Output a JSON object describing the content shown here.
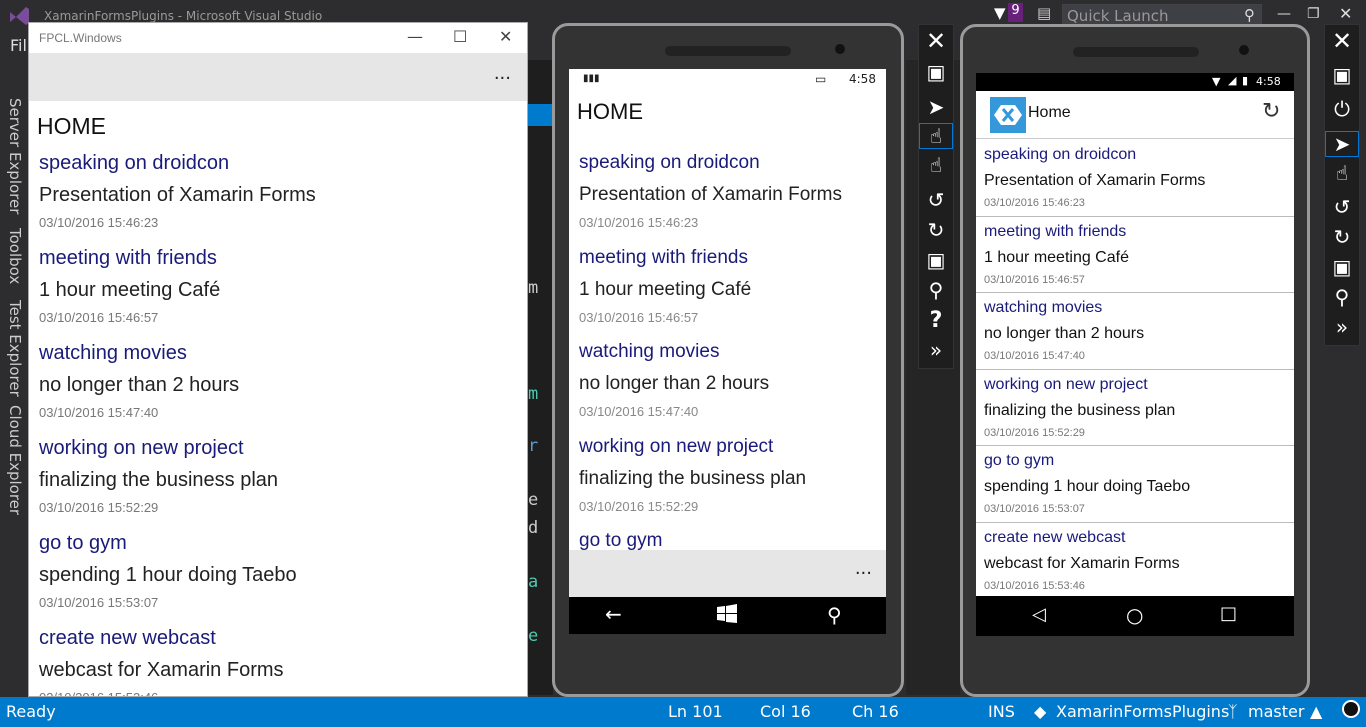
{
  "vs": {
    "title": "XamarinFormsPlugins - Microsoft Visual Studio",
    "notification_count": "9",
    "quick_launch_placeholder": "Quick Launch",
    "menu_fragment": "Fil",
    "side_tabs": [
      "Server Explorer",
      "Toolbox",
      "Test Explorer",
      "Cloud Explorer"
    ],
    "status": {
      "ready": "Ready",
      "line": "Ln 101",
      "col": "Col 16",
      "ch": "Ch 16",
      "mode": "INS",
      "repo": "XamarinFormsPlugins",
      "branch": "master"
    }
  },
  "win_app": {
    "window_title": "FPCL.Windows",
    "page_title": "HOME",
    "more_label": "..."
  },
  "wp": {
    "time": "4:58",
    "page_title": "HOME",
    "more_label": "..."
  },
  "android": {
    "time": "4:58",
    "toolbar_title": "Home"
  },
  "items": [
    {
      "title": "speaking on droidcon",
      "description": "Presentation of Xamarin Forms",
      "timestamp": "03/10/2016 15:46:23"
    },
    {
      "title": "meeting with friends",
      "description": "1 hour meeting Café",
      "timestamp": "03/10/2016 15:46:57"
    },
    {
      "title": "watching movies",
      "description": "no longer than 2 hours",
      "timestamp": "03/10/2016 15:47:40"
    },
    {
      "title": "working on new project",
      "description": "finalizing the business plan",
      "timestamp": "03/10/2016 15:52:29"
    },
    {
      "title": "go to gym",
      "description": "spending 1 hour doing Taebo",
      "timestamp": "03/10/2016 15:53:07"
    },
    {
      "title": "create new webcast",
      "description": "webcast for Xamarin Forms",
      "timestamp": "03/10/2016 15:53:46"
    }
  ],
  "colors": {
    "vs_bg": "#2d2d30",
    "vs_status": "#007acc",
    "item_title": "#1a1a7a",
    "xamarin_blue": "#3498db"
  }
}
